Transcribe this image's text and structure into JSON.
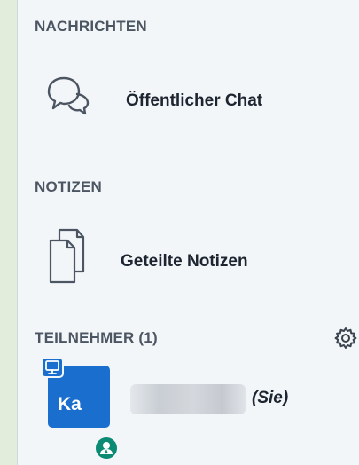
{
  "sections": {
    "messages": {
      "title": "NACHRICHTEN",
      "items": [
        {
          "label": "Öffentlicher Chat",
          "icon": "chat-bubbles-icon"
        }
      ]
    },
    "notes": {
      "title": "NOTIZEN",
      "items": [
        {
          "label": "Geteilte Notizen",
          "icon": "documents-icon"
        }
      ]
    },
    "participants": {
      "title": "TEILNEHMER (1)",
      "settings_icon": "gear-icon",
      "users": [
        {
          "initials": "Ka",
          "suffix": "(Sie)",
          "name_blurred": true,
          "avatar_color": "#1a6fce",
          "role_badge_color": "#0b8a74"
        }
      ]
    }
  }
}
